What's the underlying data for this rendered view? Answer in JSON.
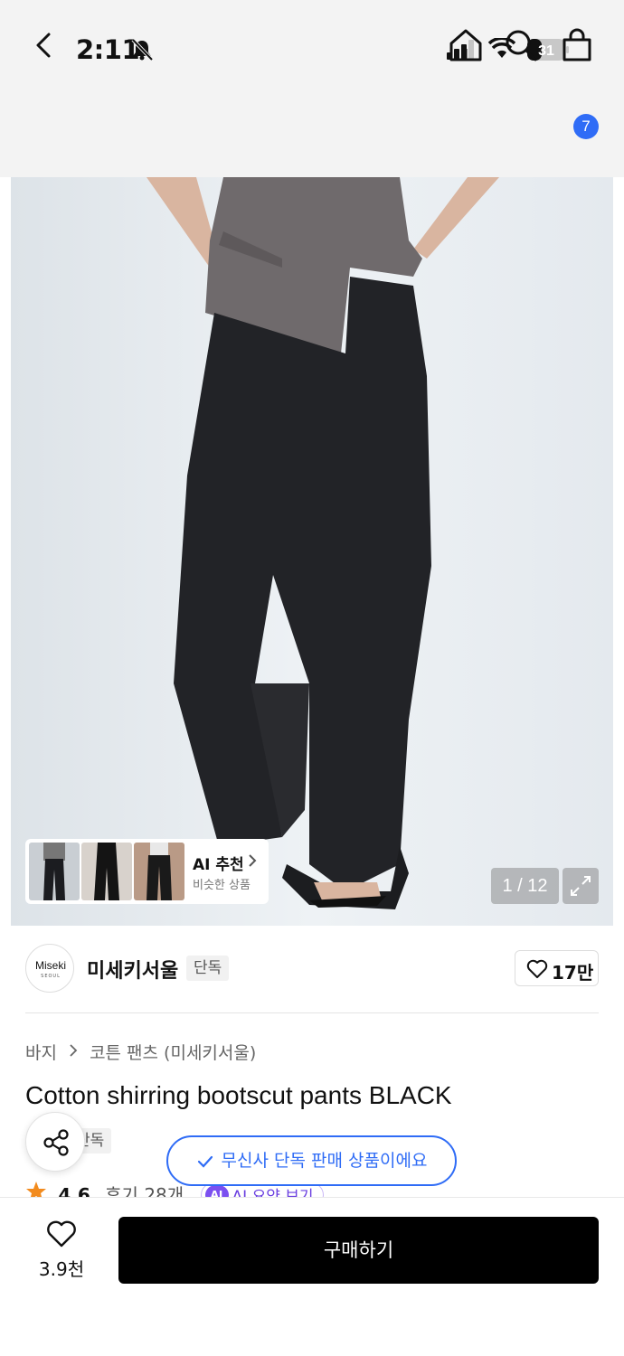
{
  "status_bar": {
    "time": "2:11",
    "battery": "31"
  },
  "nav": {
    "cart_count": "7"
  },
  "gallery": {
    "ai_card_title": "AI 추천",
    "ai_card_subtitle": "비슷한 상품",
    "page_counter": "1 / 12"
  },
  "brand": {
    "logo_text": "Miseki",
    "logo_sub": "SEOUL",
    "name": "미세키서울",
    "tag": "단독",
    "like_count": "17만"
  },
  "breadcrumb": {
    "category": "바지",
    "subcategory": "코튼 팬츠 (미세키서울)"
  },
  "product": {
    "title": "Cotton shirring bootscut pants BLACK",
    "exclusive_tag": "단독",
    "rating": "4.6",
    "review_count": "후기 28개",
    "ai_summary_badge": "AI",
    "ai_summary_label": "AI 요약 보기"
  },
  "toast": {
    "text": "무신사 단독 판매 상품이에요"
  },
  "bottom_bar": {
    "wish_count": "3.9천",
    "buy_label": "구매하기"
  },
  "colors": {
    "accent": "#2f6cf6",
    "ai_purple": "#7b4ff0",
    "buy_button": "#000000",
    "star": "#f28b1e"
  }
}
